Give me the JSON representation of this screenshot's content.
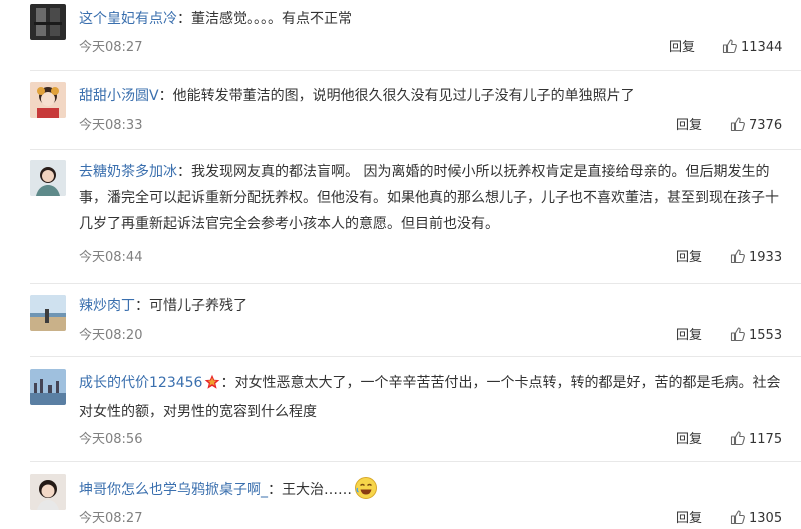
{
  "comments": [
    {
      "username": "这个皇妃有点冷",
      "separator": "：",
      "text": "董洁感觉。。。。有点不正常",
      "time": "今天08:27",
      "reply_label": "回复",
      "likes": "11344",
      "avatar_icon": "avatar-dark-window"
    },
    {
      "username": "甜甜小汤圆V",
      "separator": "：",
      "text": "他能转发带董洁的图，说明他很久很久没有见过儿子没有儿子的单独照片了",
      "time": "今天08:33",
      "reply_label": "回复",
      "likes": "7376",
      "avatar_icon": "avatar-cartoon-girl"
    },
    {
      "username": "去糖奶茶多加冰",
      "separator": "：",
      "text": "我发现网友真的都法盲啊。 因为离婚的时候小所以抚养权肯定是直接给母亲的。但后期发生的事，潘完全可以起诉重新分配抚养权。但他没有。如果他真的那么想儿子，儿子也不喜欢董洁，甚至到现在孩子十几岁了再重新起诉法官完全会参考小孩本人的意愿。但目前也没有。",
      "time": "今天08:44",
      "reply_label": "回复",
      "likes": "1933",
      "avatar_icon": "avatar-woman-portrait"
    },
    {
      "username": "辣炒肉丁",
      "separator": "：",
      "text": "可惜儿子养残了",
      "time": "今天08:20",
      "reply_label": "回复",
      "likes": "1553",
      "avatar_icon": "avatar-beach-scene"
    },
    {
      "username": "成长的代价123456",
      "separator": "：",
      "text": "对女性恶意太大了，一个辛辛苦苦付出，一个卡点转，转的都是好，苦的都是毛病。社会对女性的额，对男性的宽容到什么程度",
      "time": "今天08:56",
      "reply_label": "回复",
      "likes": "1175",
      "avatar_icon": "avatar-city-skyline",
      "badge_icon": "red-star-icon"
    },
    {
      "username": "坤哥你怎么也学乌鸦掀桌子啊_",
      "separator": "：",
      "text": "王大治……",
      "time": "今天08:27",
      "reply_label": "回复",
      "likes": "1305",
      "avatar_icon": "avatar-girl-portrait",
      "emoji_icon": "laughing-emoji-icon"
    }
  ],
  "colors": {
    "username": "#3a6fae",
    "text": "#333333",
    "time": "#808080",
    "divider": "#e8e8e8"
  }
}
